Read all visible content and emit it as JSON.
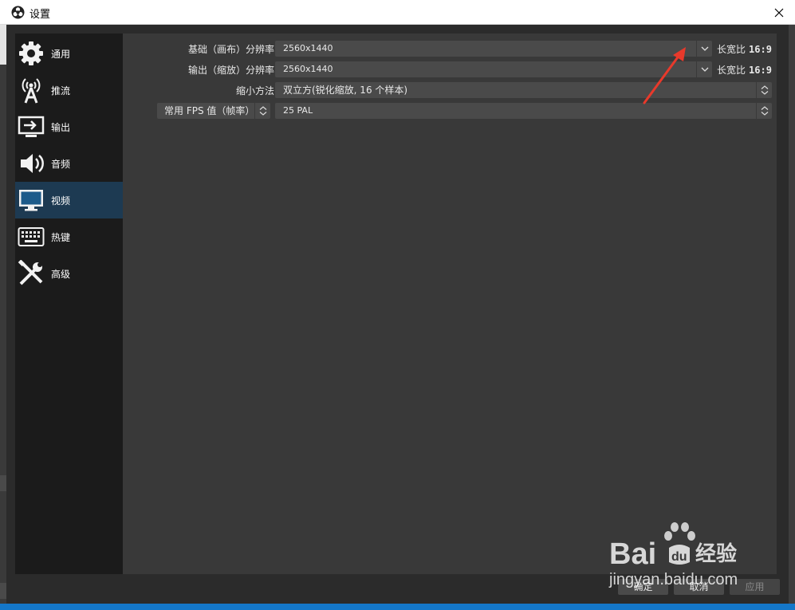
{
  "window": {
    "title": "设置",
    "close_glyph": "✕"
  },
  "sidebar": {
    "items": [
      {
        "label": "通用",
        "icon": "gear-icon"
      },
      {
        "label": "推流",
        "icon": "broadcast-antenna-icon"
      },
      {
        "label": "输出",
        "icon": "monitor-output-icon"
      },
      {
        "label": "音频",
        "icon": "speaker-icon"
      },
      {
        "label": "视频",
        "icon": "monitor-icon",
        "active": true
      },
      {
        "label": "热键",
        "icon": "keyboard-icon"
      },
      {
        "label": "高级",
        "icon": "wrench-screwdriver-icon"
      }
    ]
  },
  "video": {
    "base_resolution": {
      "label": "基础（画布）分辨率",
      "value": "2560x1440",
      "aspect_label": "长宽比",
      "aspect_value": "16:9"
    },
    "output_resolution": {
      "label": "输出（缩放）分辨率",
      "value": "2560x1440",
      "aspect_label": "长宽比",
      "aspect_value": "16:9"
    },
    "downscale_filter": {
      "label": "缩小方法",
      "value": "双立方(锐化缩放, 16 个样本)"
    },
    "fps": {
      "type_label": "常用 FPS 值（帧率）",
      "value": "25 PAL"
    }
  },
  "footer": {
    "ok_label": "确定",
    "cancel_label": "取消",
    "apply_label": "应用"
  },
  "watermark": {
    "brand": "Bai",
    "brand_suffix": "经验",
    "url": "jingyan.baidu.com"
  },
  "colors": {
    "accent_active": "#1d3a52",
    "annotation_arrow": "#e8392b"
  }
}
